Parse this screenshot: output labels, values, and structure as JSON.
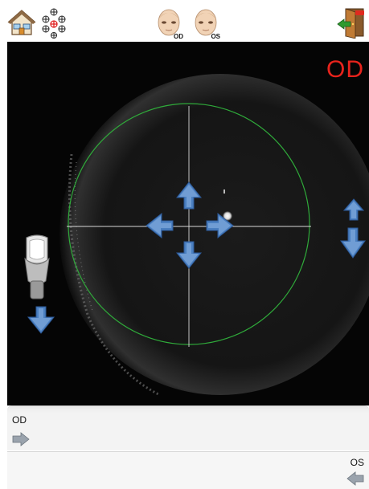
{
  "toolbar": {
    "od_label": "OD",
    "os_label": "OS"
  },
  "camera": {
    "eye_label": "OD"
  },
  "panels": {
    "od_label": "OD",
    "os_label": "OS"
  },
  "icons": {
    "home": "home-icon",
    "fixation": "fixation-targets-icon",
    "eye_od": "patient-face-od-icon",
    "eye_os": "patient-face-os-icon",
    "exit": "exit-door-icon",
    "chinrest": "chinrest-icon"
  },
  "colors": {
    "eye_label": "#e8231c",
    "arrow_blue": "#4a7fc0",
    "alignment_circle": "#2faa3a",
    "crosshair": "#d8d8d8"
  }
}
